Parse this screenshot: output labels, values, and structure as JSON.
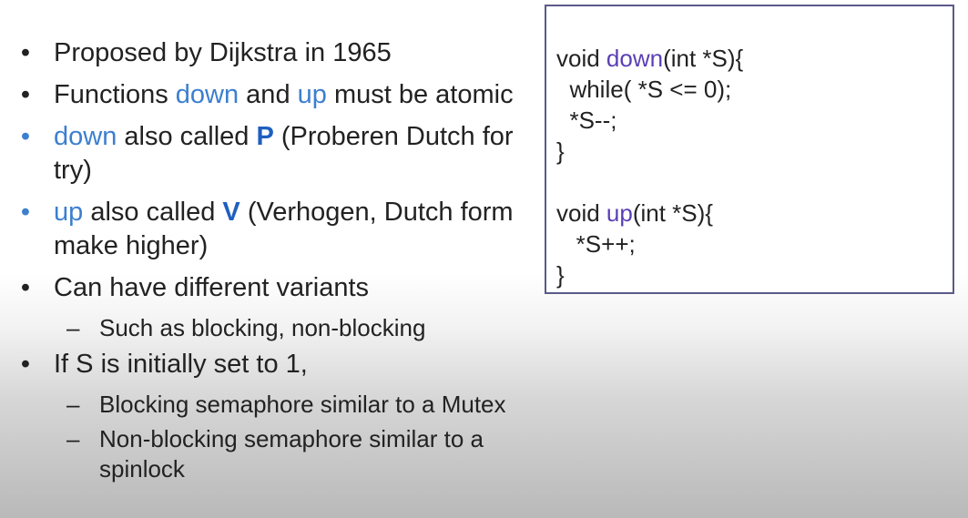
{
  "bullets": [
    {
      "parts": [
        "Proposed by Dijkstra in 1965"
      ]
    },
    {
      "parts": [
        "Functions ",
        "down",
        " and ",
        "up",
        " must be atomic"
      ]
    },
    {
      "parts": [
        "down",
        " also called ",
        "P",
        " (Proberen Dutch for try)"
      ]
    },
    {
      "parts": [
        "up",
        " also called ",
        "V",
        " (Verhogen, Dutch form make higher)"
      ]
    },
    {
      "parts": [
        "Can have different variants"
      ],
      "subs": [
        "Such as blocking, non-blocking"
      ]
    },
    {
      "parts": [
        "If S is initially set to 1,"
      ],
      "subs": [
        "Blocking semaphore similar to a Mutex",
        "Non-blocking semaphore similar to a spinlock"
      ]
    }
  ],
  "bullet_symbol": "•",
  "dash_symbol": "–",
  "code": {
    "l1a": "void ",
    "l1b": "down",
    "l1c": "(int *S){",
    "l2": "  while( *S <= 0);",
    "l3": "  *S--;",
    "l4": "}",
    "l5": "",
    "l6a": "void ",
    "l6b": "up",
    "l6c": "(int *S){",
    "l7": "   *S++;",
    "l8": "}"
  },
  "colors": {
    "highlight": "#3c7fcf",
    "code_keyword": "#5b3fb5",
    "code_border": "#5a5a8a"
  }
}
